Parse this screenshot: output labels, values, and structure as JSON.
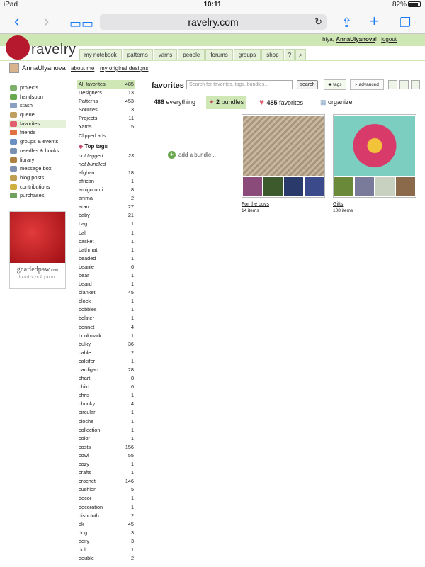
{
  "status": {
    "device": "iPad",
    "time": "10:11",
    "battery": "82%"
  },
  "browser": {
    "url": "ravelry.com"
  },
  "header": {
    "logo": "ravelry",
    "greeting_prefix": "hiya, ",
    "user": "AnnaUlyanova",
    "greeting_suffix": "!",
    "logout": "logout",
    "nav": [
      "my notebook",
      "patterns",
      "yarns",
      "people",
      "forums",
      "groups",
      "shop"
    ]
  },
  "userbar": {
    "name": "AnnaUlyanova",
    "about": "about me",
    "designs": "my original designs"
  },
  "sidebar": [
    {
      "label": "projects",
      "color": "#7fb069"
    },
    {
      "label": "handspun",
      "color": "#6aa84f"
    },
    {
      "label": "stash",
      "color": "#8a9fc2"
    },
    {
      "label": "queue",
      "color": "#c0a060"
    },
    {
      "label": "favorites",
      "color": "#e06070"
    },
    {
      "label": "friends",
      "color": "#e07040"
    },
    {
      "label": "groups & events",
      "color": "#6a8fc2"
    },
    {
      "label": "needles & hooks",
      "color": "#7a90b0"
    },
    {
      "label": "library",
      "color": "#b08040"
    },
    {
      "label": "message box",
      "color": "#8090b0"
    },
    {
      "label": "blog posts",
      "color": "#c0a050"
    },
    {
      "label": "contributions",
      "color": "#d0b040"
    },
    {
      "label": "purchases",
      "color": "#70a060"
    }
  ],
  "ad": {
    "brand": "gnarledpaw",
    "domain": ".com",
    "tagline": "hand-dyed yarns"
  },
  "categories": [
    {
      "label": "All favorites",
      "count": "485"
    },
    {
      "label": "Designers",
      "count": "13"
    },
    {
      "label": "Patterns",
      "count": "453"
    },
    {
      "label": "Sources",
      "count": "3"
    },
    {
      "label": "Projects",
      "count": "11"
    },
    {
      "label": "Yarns",
      "count": "5"
    },
    {
      "label": "Clipped ads",
      "count": ""
    }
  ],
  "top_tags_heading": "Top tags",
  "special_tags": [
    {
      "label": "not tagged",
      "count": "23"
    },
    {
      "label": "not bundled",
      "count": ""
    }
  ],
  "tags": [
    {
      "label": "afghan",
      "count": "18"
    },
    {
      "label": "african",
      "count": "1"
    },
    {
      "label": "amigurumi",
      "count": "8"
    },
    {
      "label": "animal",
      "count": "2"
    },
    {
      "label": "aran",
      "count": "27"
    },
    {
      "label": "baby",
      "count": "21"
    },
    {
      "label": "bag",
      "count": "1"
    },
    {
      "label": "ball",
      "count": "1"
    },
    {
      "label": "basket",
      "count": "1"
    },
    {
      "label": "bathmat",
      "count": "1"
    },
    {
      "label": "beaded",
      "count": "1"
    },
    {
      "label": "beanie",
      "count": "6"
    },
    {
      "label": "bear",
      "count": "1"
    },
    {
      "label": "beard",
      "count": "1"
    },
    {
      "label": "blanket",
      "count": "45"
    },
    {
      "label": "block",
      "count": "1"
    },
    {
      "label": "bobbles",
      "count": "1"
    },
    {
      "label": "bolster",
      "count": "1"
    },
    {
      "label": "bonnet",
      "count": "4"
    },
    {
      "label": "bookmark",
      "count": "1"
    },
    {
      "label": "bulky",
      "count": "36"
    },
    {
      "label": "cable",
      "count": "2"
    },
    {
      "label": "calcifer",
      "count": "1"
    },
    {
      "label": "cardigan",
      "count": "28"
    },
    {
      "label": "chart",
      "count": "8"
    },
    {
      "label": "child",
      "count": "6"
    },
    {
      "label": "chris",
      "count": "1"
    },
    {
      "label": "chunky",
      "count": "4"
    },
    {
      "label": "circular",
      "count": "1"
    },
    {
      "label": "cloche",
      "count": "1"
    },
    {
      "label": "collection",
      "count": "1"
    },
    {
      "label": "color",
      "count": "1"
    },
    {
      "label": "costs",
      "count": "156"
    },
    {
      "label": "cowl",
      "count": "55"
    },
    {
      "label": "cozy",
      "count": "1"
    },
    {
      "label": "crafts",
      "count": "1"
    },
    {
      "label": "crochet",
      "count": "146"
    },
    {
      "label": "cushion",
      "count": "5"
    },
    {
      "label": "decor",
      "count": "1"
    },
    {
      "label": "decoration",
      "count": "1"
    },
    {
      "label": "dishcloth",
      "count": "2"
    },
    {
      "label": "dk",
      "count": "45"
    },
    {
      "label": "dog",
      "count": "3"
    },
    {
      "label": "doily",
      "count": "3"
    },
    {
      "label": "doll",
      "count": "1"
    },
    {
      "label": "double",
      "count": "2"
    }
  ],
  "main": {
    "title": "favorites",
    "search_placeholder": "Search for favorites, tags, bundles...",
    "search_button": "search",
    "tags_button": "tags",
    "advanced_button": "advanced",
    "count_everything_num": "488",
    "count_everything_label": " everything",
    "count_bundles_num": "2",
    "count_bundles_label": " bundles",
    "count_favorites_num": "485",
    "count_favorites_label": " favorites",
    "organize": "organize",
    "add_bundle": "add a bundle..."
  },
  "bundles": [
    {
      "name": "For the guys",
      "count": "14 items",
      "colors": [
        "#b9a58e",
        "#8a4a7a",
        "#3c5a2c",
        "#2a3a6a",
        "#3a4a8a"
      ]
    },
    {
      "name": "Gifts",
      "count": "108 items",
      "colors": [
        "#d83a6a",
        "#6a8a3a",
        "#7a7a9a",
        "#c8d0c0",
        "#8a6a4a"
      ]
    }
  ]
}
